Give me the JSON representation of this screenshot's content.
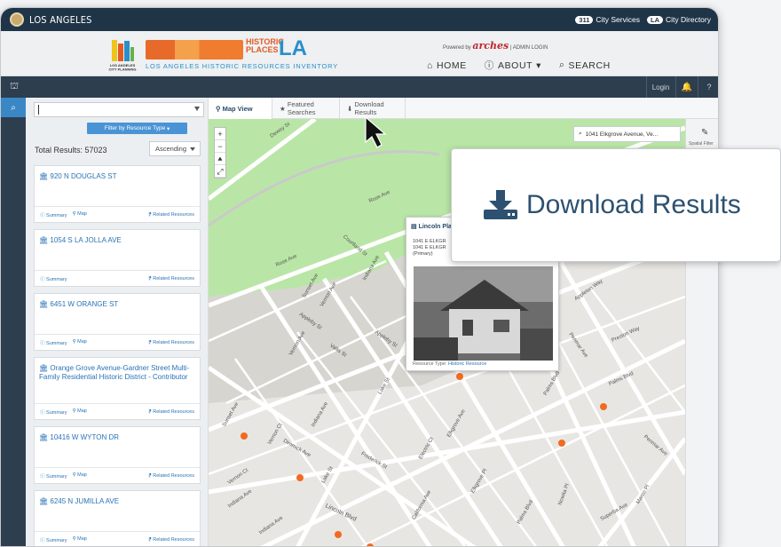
{
  "topbar": {
    "brand": "LOS ANGELES",
    "city_services_badge": "311",
    "city_services": "City Services",
    "city_directory_badge": "LA",
    "city_directory": "City Directory"
  },
  "header": {
    "lacp_logo_text": "LOS ANGELES CITY PLANNING",
    "hp_historic": "HISTORIC",
    "hp_places": "PLACES",
    "hp_la": "LA",
    "hp_subtitle": "LOS ANGELES HISTORIC RESOURCES INVENTORY",
    "powered_by": "Powered by",
    "arches": "arches",
    "admin_login": "| ADMIN LOGIN",
    "nav": {
      "home": "HOME",
      "about": "ABOUT",
      "search": "SEARCH"
    }
  },
  "navbar": {
    "login": "Login",
    "help": "?"
  },
  "search": {
    "input_value": "",
    "filter_button": "Filter by Resource Type",
    "total_label": "Total Results: 57023",
    "sort": "Ascending"
  },
  "results": [
    {
      "title": "920 N DOUGLAS ST",
      "summary": "Summary",
      "map": "Map",
      "related": "Related Resources"
    },
    {
      "title": "1054 S LA JOLLA AVE",
      "summary": "Summary",
      "map": "",
      "related": "Related Resources"
    },
    {
      "title": "6451 W ORANGE ST",
      "summary": "Summary",
      "map": "Map",
      "related": "Related Resources"
    },
    {
      "title": "Orange Grove Avenue-Gardner Street Multi-Family Residential Historic District - Contributor",
      "summary": "Summary",
      "map": "Map",
      "related": "Related Resources"
    },
    {
      "title": "10416 W WYTON DR",
      "summary": "Summary",
      "map": "Map",
      "related": "Related Resources"
    },
    {
      "title": "6245 N JUMILLA AVE",
      "summary": "Summary",
      "map": "Map",
      "related": "Related Resources"
    }
  ],
  "tabs": {
    "map_view": "Map View",
    "featured": "Featured Searches",
    "download": "Download Results"
  },
  "map": {
    "address": "1041 Elkgrove Avenue, Ve...",
    "spatial_filter": "Spatial Filter",
    "zoom_in": "+",
    "zoom_out": "−",
    "streets": [
      "Dewey St",
      "Rose Ave",
      "Rose Ave",
      "Courtland St",
      "Sunset Ave",
      "Vernon Ave",
      "Indiana Ave",
      "Appleby St",
      "Appleby St",
      "Vallis St",
      "Lake St",
      "Vernon Ave",
      "Sunset Ave",
      "Indiana Ave",
      "Vernon Ct",
      "Dimmick Ave",
      "Frederick St",
      "Lake St",
      "Elkgrove Ave",
      "Electric Ct",
      "California Ave",
      "Elkgrove Pl",
      "Palms Blvd",
      "Palms Blvd",
      "Nowita Pl",
      "Superba Ave",
      "Marco Pl",
      "Penmar Ave",
      "Preston Way",
      "Penmar Ave",
      "Palms Blvd",
      "Lincoln Blvd",
      "Indiana Ave",
      "Indiana Ave",
      "Vernon Ct",
      "Appleton Way"
    ]
  },
  "popup": {
    "title": "Lincoln Plac",
    "addr1": "1041 E ELKGR",
    "addr2": "1041 E ELKGR",
    "addr3": "(Primary)",
    "type_label": "Resource Type:",
    "type_value": "Historic Resource"
  },
  "zoom_callout": {
    "label": "Download Results"
  }
}
